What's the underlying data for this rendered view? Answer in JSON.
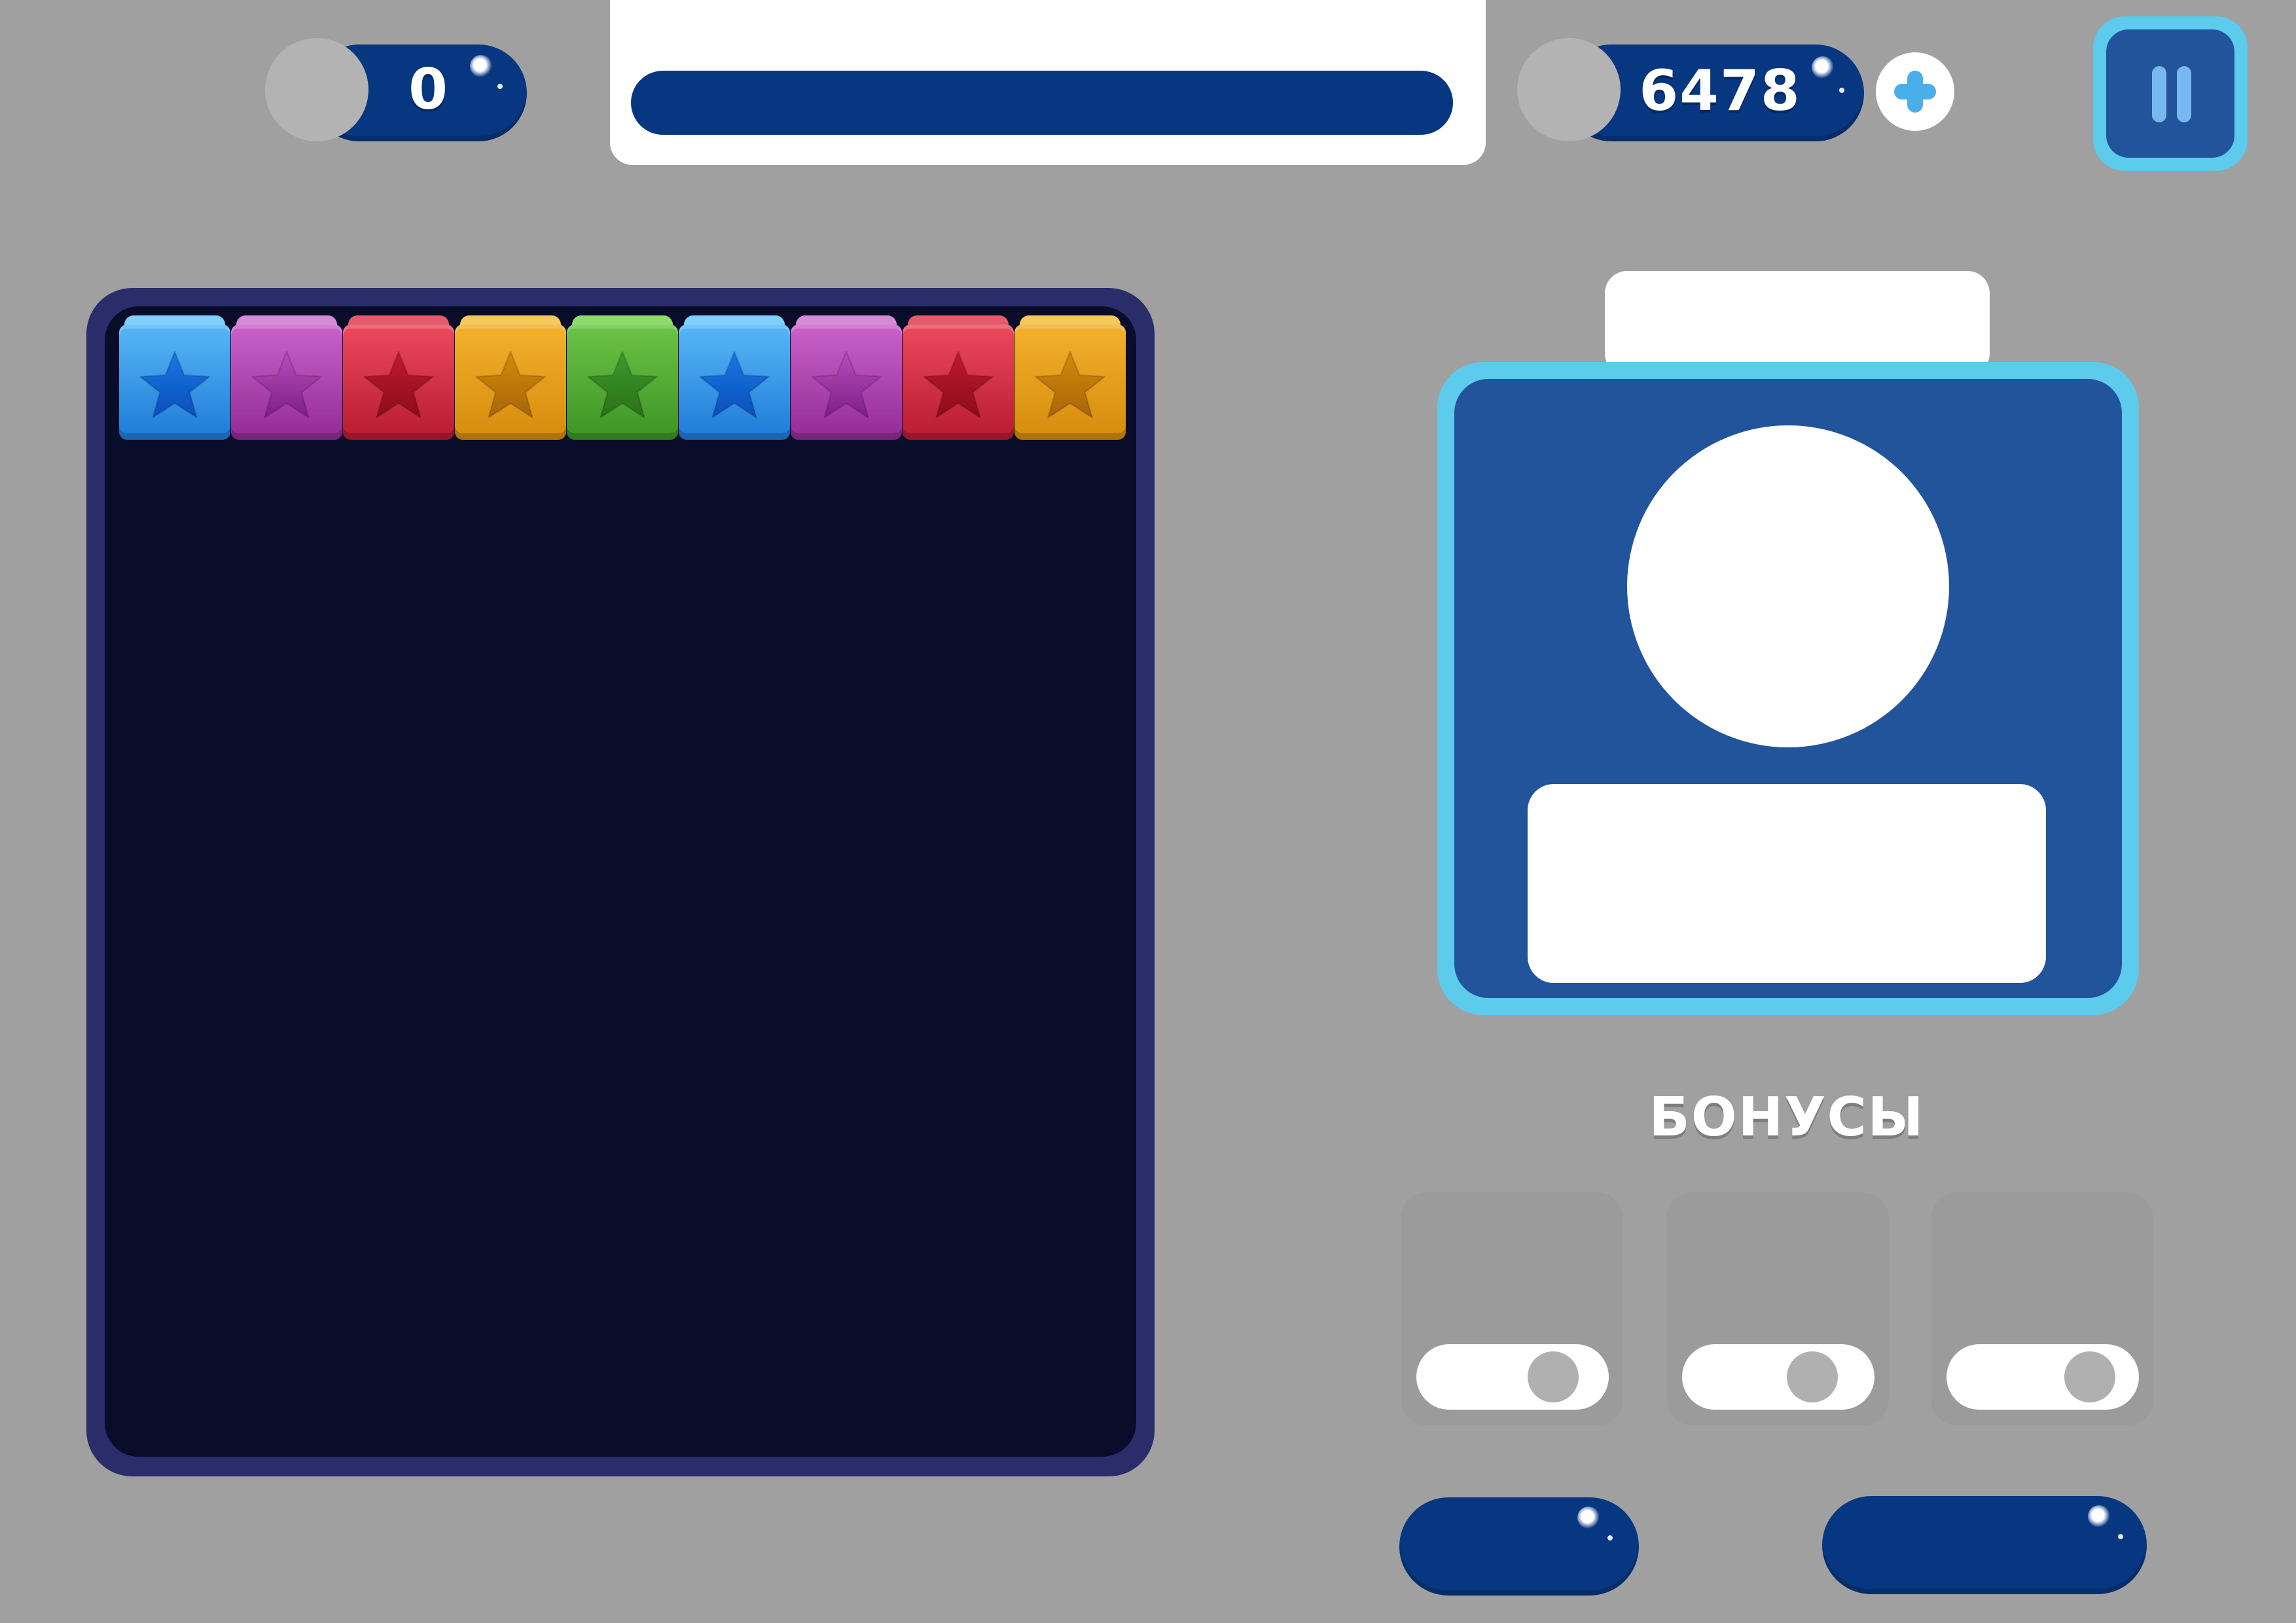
{
  "hud": {
    "moves": {
      "value": "0"
    },
    "coins": {
      "value": "6478"
    },
    "level_progress": 0
  },
  "board": {
    "top_row": [
      {
        "color": "blue",
        "icon": "star-icon"
      },
      {
        "color": "purple",
        "icon": "star-icon"
      },
      {
        "color": "red",
        "icon": "star-icon"
      },
      {
        "color": "orange",
        "icon": "star-icon"
      },
      {
        "color": "green",
        "icon": "star-icon"
      },
      {
        "color": "blue",
        "icon": "star-icon"
      },
      {
        "color": "purple",
        "icon": "star-icon"
      },
      {
        "color": "red",
        "icon": "star-icon"
      },
      {
        "color": "orange",
        "icon": "star-icon"
      }
    ]
  },
  "bonuses": {
    "title": "БОНУСЫ",
    "items": [
      {
        "toggle_on": true
      },
      {
        "toggle_on": true
      },
      {
        "toggle_on": true
      }
    ]
  },
  "colors": {
    "background": "#a0a0a0",
    "accent_dark_blue": "#083781",
    "panel_blue": "#22549b",
    "panel_border": "#5ccbec",
    "board_bg": "#0a0d2a",
    "board_border": "#2a2d6a"
  }
}
